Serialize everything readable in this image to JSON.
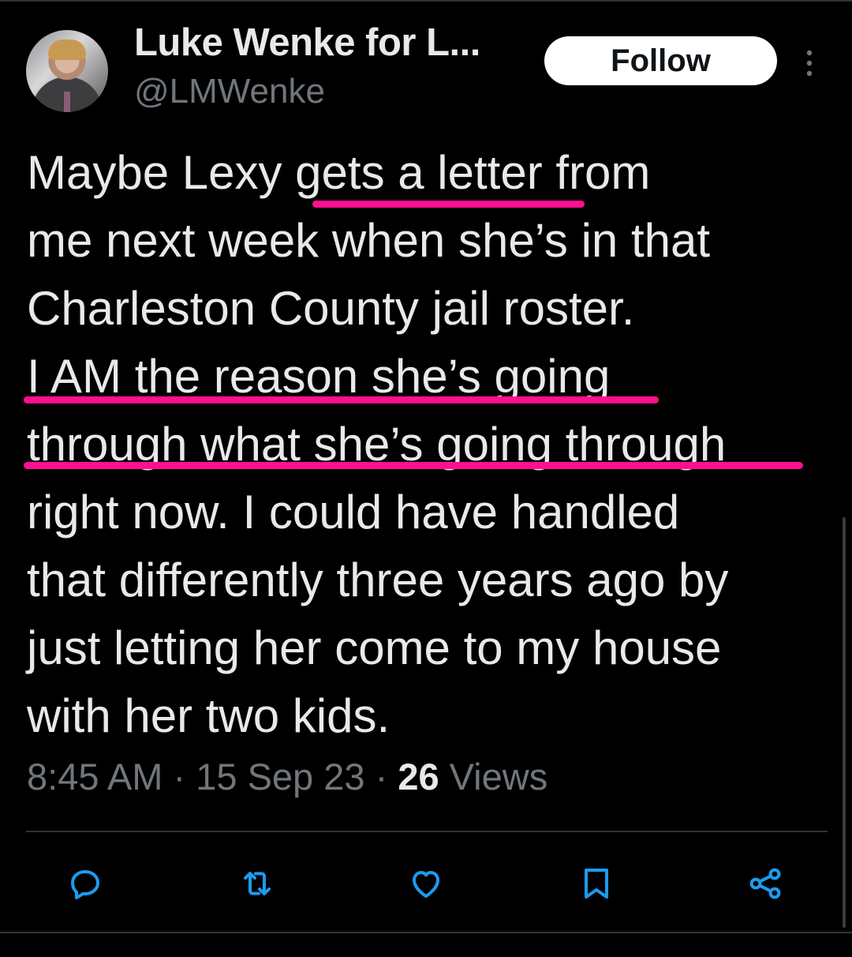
{
  "author": {
    "display_name": "Luke Wenke for L...",
    "handle": "@LMWenke"
  },
  "follow_label": "Follow",
  "tweet": {
    "lines": [
      "Maybe Lexy gets a letter from",
      "me next week when she’s in that",
      "Charleston County jail roster.",
      "I AM the reason she’s going",
      "through what she’s going through",
      "right now.  I could have handled",
      "that differently three years ago by",
      "just letting her come to my house",
      "with her two kids."
    ],
    "highlighted_phrases": [
      "gets a letter",
      "I AM the reason she’s going",
      "through what she’s going through"
    ],
    "highlight_color": "#ff0f8f"
  },
  "meta": {
    "time": "8:45 AM",
    "separator": "·",
    "date": "15 Sep 23",
    "views_count": "26",
    "views_label": "Views"
  },
  "actions": {
    "reply_icon": "reply-icon",
    "retweet_icon": "retweet-icon",
    "like_icon": "heart-icon",
    "bookmark_icon": "bookmark-icon",
    "share_icon": "share-icon"
  },
  "colors": {
    "background": "#000000",
    "text": "#e7e9ea",
    "secondary_text": "#71767b",
    "border": "#2f3336"
  }
}
